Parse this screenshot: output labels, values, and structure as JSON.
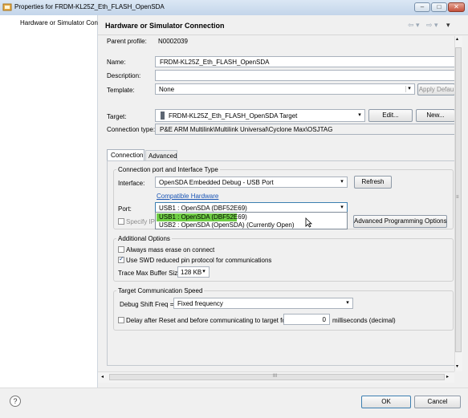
{
  "window": {
    "title": "Properties for FRDM-KL25Z_Eth_FLASH_OpenSDA",
    "minimize": "–",
    "maximize": "□",
    "close": "✕"
  },
  "left_nav": {
    "items": [
      {
        "label": "Hardware or Simulator Conr"
      }
    ]
  },
  "header": {
    "title": "Hardware or Simulator Connection",
    "back_arrow": "⇦ ▾",
    "forward_arrow": "⇨ ▾",
    "menu_arrow": "▾"
  },
  "form": {
    "parent_profile_label": "Parent profile:",
    "parent_profile_value": "N0002039",
    "name_label": "Name:",
    "name_value": "FRDM-KL25Z_Eth_FLASH_OpenSDA",
    "description_label": "Description:",
    "description_value": "",
    "template_label": "Template:",
    "template_value": "None",
    "apply_default": "Apply Defau",
    "target_label": "Target:",
    "target_value": "FRDM-KL25Z_Eth_FLASH_OpenSDA Target",
    "edit_button": "Edit...",
    "new_button": "New...",
    "connection_type_label": "Connection type:",
    "connection_type_value": "P&E ARM Multilink\\Multilink Universal\\Cyclone Max\\OSJTAG"
  },
  "tabs": [
    {
      "label": "Connection",
      "selected": true
    },
    {
      "label": "Advanced",
      "selected": false
    }
  ],
  "connection_group": {
    "title": "Connection port and Interface Type",
    "interface_label": "Interface:",
    "interface_value": "OpenSDA Embedded Debug - USB Port",
    "refresh_button": "Refresh",
    "compatible_link": "Compatible Hardware",
    "port_label": "Port:",
    "port_value": "USB1 : OpenSDA (DBF52E69)",
    "port_options": [
      {
        "label": "USB1 : OpenSDA (DBF52E69)",
        "highlighted": true
      },
      {
        "label": "USB2 : OpenSDA (OpenSDA) (Currently Open)",
        "highlighted": false
      }
    ],
    "specify_ip_label": "Specify IP",
    "advanced_prog_button": "Advanced Programming Options"
  },
  "additional_group": {
    "title": "Additional Options",
    "mass_erase_label": "Always mass erase on connect",
    "mass_erase_checked": false,
    "swd_label": "Use SWD reduced pin protocol for communications",
    "swd_checked": true,
    "trace_label": "Trace Max Buffer Size:",
    "trace_value": "128 KB"
  },
  "speed_group": {
    "title": "Target Communication Speed",
    "debug_shift_label": "Debug Shift Freq =",
    "debug_shift_value": "Fixed frequency",
    "delay_label": "Delay after Reset and before communicating to target for",
    "delay_value": "0",
    "delay_unit": "milliseconds (decimal)"
  },
  "scroll": {
    "h_label": "III",
    "v_grip": "≡"
  },
  "footer": {
    "help_icon_text": "?",
    "ok_button": "OK",
    "cancel_button": "Cancel"
  },
  "colors": {
    "highlight": "#6fce45",
    "link": "#1a55b5",
    "ok_border": "#3c7fb1"
  }
}
